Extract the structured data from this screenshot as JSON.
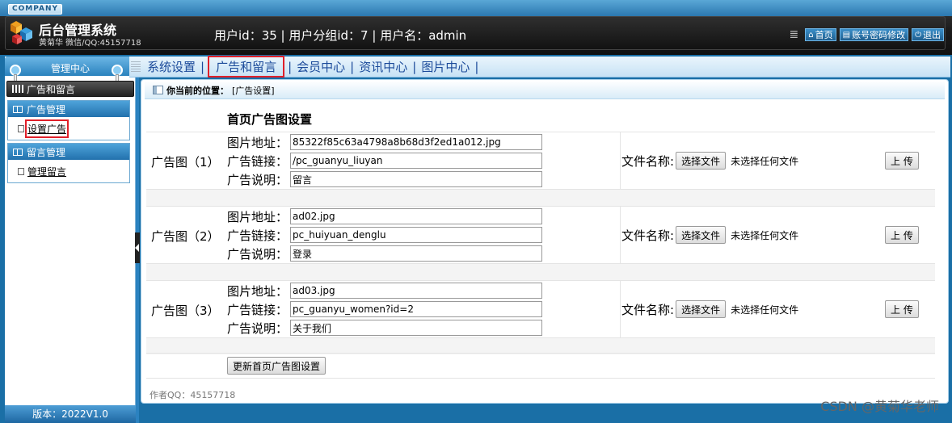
{
  "header": {
    "company": "COMPANY",
    "title": "后台管理系统",
    "subtitle": "黄菊华 微信/QQ:45157718",
    "user_info": "用户id：35 | 用户分组id：7 | 用户名：admin",
    "links": [
      {
        "icon": "home-icon",
        "label": "首页"
      },
      {
        "icon": "document-icon",
        "label": "账号密码修改"
      },
      {
        "icon": "power-icon",
        "label": "退出"
      }
    ]
  },
  "sidebar": {
    "title": "管理中心",
    "active": "广告和留言",
    "groups": [
      {
        "title": "广告管理",
        "items": [
          "设置广告"
        ]
      },
      {
        "title": "留言管理",
        "items": [
          "管理留言"
        ]
      }
    ],
    "version": "版本：2022V1.0"
  },
  "nav": {
    "items": [
      "系统设置",
      "广告和留言",
      "会员中心",
      "资讯中心",
      "图片中心"
    ],
    "active_index": 1,
    "separator": "|"
  },
  "breadcrumb": {
    "label": "你当前的位置：",
    "value": "[广告设置]"
  },
  "form": {
    "heading": "首页广告图设置",
    "field_labels": {
      "image": "图片地址：",
      "link": "广告链接：",
      "desc": "广告说明："
    },
    "file_label": "文件名称:",
    "choose_button": "选择文件",
    "no_file": "未选择任何文件",
    "upload_button": "上 传",
    "ads": [
      {
        "label": "广告图（1）",
        "image": "85322f85c63a4798a8b68d3f2ed1a012.jpg",
        "link": "/pc_guanyu_liuyan",
        "desc": "留言"
      },
      {
        "label": "广告图（2）",
        "image": "ad02.jpg",
        "link": "pc_huiyuan_denglu",
        "desc": "登录"
      },
      {
        "label": "广告图（3）",
        "image": "ad03.jpg",
        "link": "pc_guanyu_women?id=2",
        "desc": "关于我们"
      }
    ],
    "submit_button": "更新首页广告图设置"
  },
  "footer": {
    "author": "作者QQ：45157718",
    "watermark": "CSDN @黄菊华老师"
  }
}
